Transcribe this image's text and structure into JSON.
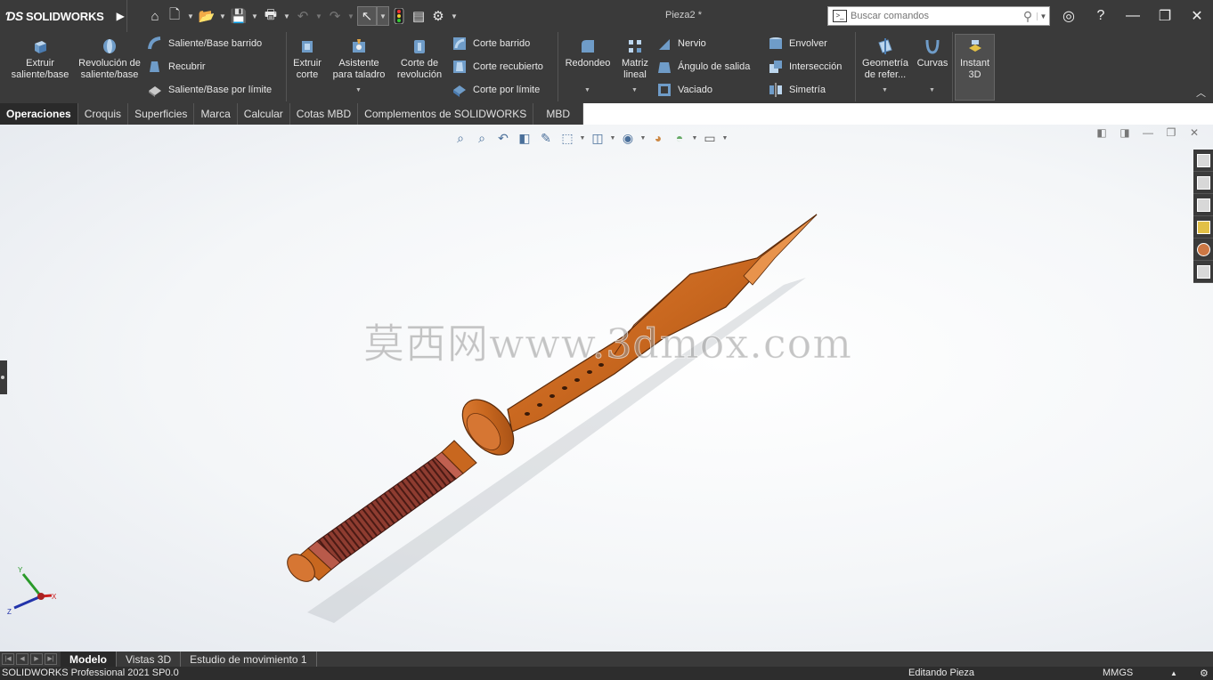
{
  "app": {
    "logo_text": "SOLIDWORKS",
    "document_title": "Pieza2 *"
  },
  "search": {
    "placeholder": "Buscar comandos"
  },
  "ribbon": {
    "extruir_saliente": "Extruir saliente/base",
    "revolucion_saliente": "Revolución de saliente/base",
    "saliente_barrido": "Saliente/Base barrido",
    "recubrir": "Recubrir",
    "saliente_limite": "Saliente/Base por límite",
    "extruir_corte": "Extruir corte",
    "asistente_taladro": "Asistente para taladro",
    "corte_revolucion": "Corte de revolución",
    "corte_barrido": "Corte barrido",
    "corte_recubierto": "Corte recubierto",
    "corte_limite": "Corte por límite",
    "redondeo": "Redondeo",
    "matriz_lineal": "Matriz lineal",
    "nervio": "Nervio",
    "angulo_salida": "Ángulo de salida",
    "vaciado": "Vaciado",
    "envolver": "Envolver",
    "interseccion": "Intersección",
    "simetria": "Simetría",
    "geometria_referencia": "Geometría de refer...",
    "curvas": "Curvas",
    "instant3d": "Instant 3D"
  },
  "tabs": [
    "Operaciones",
    "Croquis",
    "Superficies",
    "Marca",
    "Calcular",
    "Cotas MBD",
    "Complementos de SOLIDWORKS",
    "MBD"
  ],
  "active_tab": "Operaciones",
  "viewport": {
    "watermark": "莫西网www.3dmox.com",
    "model_color": "#c8671f",
    "triad": {
      "x": "X",
      "y": "Y",
      "z": "Z"
    }
  },
  "bottom_tabs": [
    "Modelo",
    "Vistas 3D",
    "Estudio de movimiento 1"
  ],
  "status": {
    "version": "SOLIDWORKS Professional 2021 SP0.0",
    "mode": "Editando Pieza",
    "units": "MMGS"
  }
}
